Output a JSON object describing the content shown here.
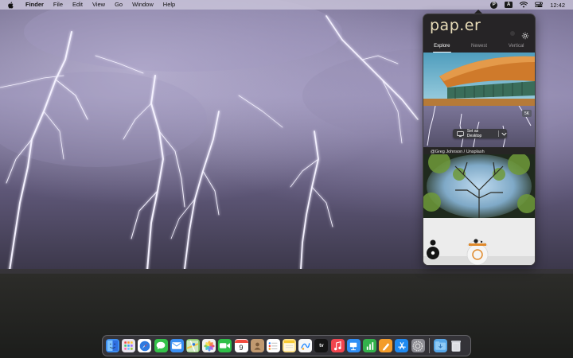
{
  "menubar": {
    "apple_icon": "apple-icon",
    "app_name": "Finder",
    "menus": [
      "File",
      "Edit",
      "View",
      "Go",
      "Window",
      "Help"
    ],
    "status_icons": [
      "paper-status-icon",
      "input-source-icon",
      "wifi-icon",
      "control-center-icon"
    ],
    "input_source_label": "A",
    "paper_status_label": "P",
    "clock": "12:42"
  },
  "popover": {
    "logo": "pap.er",
    "tabs": [
      {
        "label": "Explore",
        "active": true
      },
      {
        "label": "Newest",
        "active": false
      },
      {
        "label": "Vertical",
        "active": false
      }
    ],
    "cards": [
      {
        "subject": "orange-architecture-photo"
      },
      {
        "subject": "lightning-storm-photo",
        "badge": "5K",
        "action_label": "Set as Desktop",
        "credit": "@Greg Johnson / Unsplash"
      },
      {
        "subject": "tree-canopy-photo"
      },
      {
        "subject": "bb8-toy-photo"
      }
    ]
  },
  "dock": {
    "apps": [
      {
        "name": "Finder",
        "color": "#3d8ef0"
      },
      {
        "name": "Launchpad",
        "color": "#e8e4ee"
      },
      {
        "name": "Safari",
        "color": "#2e7ae0"
      },
      {
        "name": "Messages",
        "color": "#35c24a"
      },
      {
        "name": "Mail",
        "color": "#3a8ff2"
      },
      {
        "name": "Maps",
        "color": "#8bc870"
      },
      {
        "name": "Photos",
        "color": "#f2f2f2"
      },
      {
        "name": "FaceTime",
        "color": "#2fbf48"
      },
      {
        "name": "Calendar",
        "color": "#ffffff",
        "label": "9"
      },
      {
        "name": "Contacts",
        "color": "#c19a70"
      },
      {
        "name": "Reminders",
        "color": "#ffffff"
      },
      {
        "name": "Notes",
        "color": "#fbe08a"
      },
      {
        "name": "Freeform",
        "color": "#f7f7f7"
      },
      {
        "name": "Apple TV",
        "color": "#151515",
        "label": "tv"
      },
      {
        "name": "Music",
        "color": "#f2454e"
      },
      {
        "name": "Keynote",
        "color": "#2f8ef4"
      },
      {
        "name": "Numbers",
        "color": "#33b14b"
      },
      {
        "name": "Pages",
        "color": "#f39c2a"
      },
      {
        "name": "App Store",
        "color": "#1f8af0"
      },
      {
        "name": "System Settings",
        "color": "#8c8c93"
      },
      {
        "name": "Downloads",
        "color": "#57a7e8"
      },
      {
        "name": "Trash",
        "color": "#cfd2d8"
      }
    ]
  }
}
